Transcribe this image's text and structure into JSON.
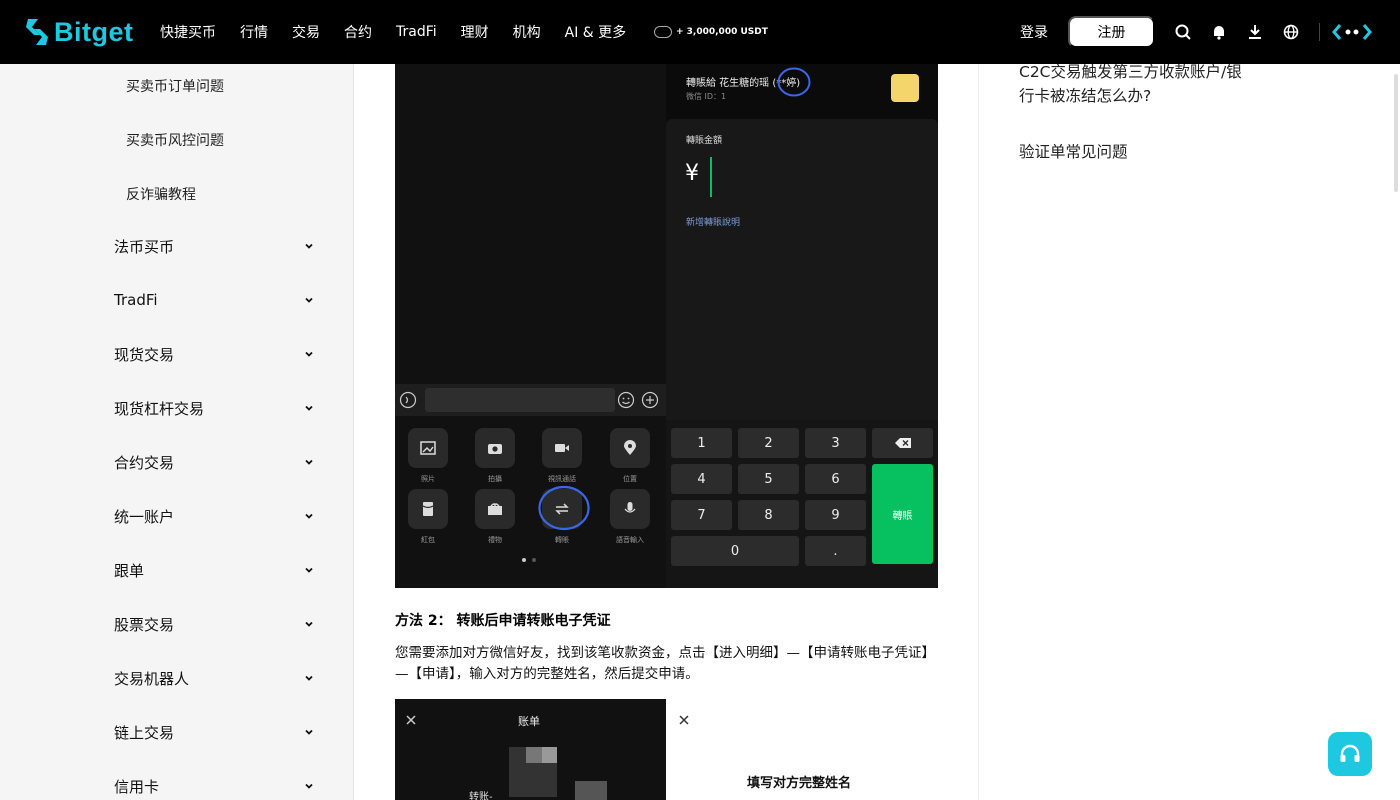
{
  "brand": {
    "name": "Bitget",
    "accent": "#1ec8e0"
  },
  "nav": {
    "items": [
      "快捷买币",
      "行情",
      "交易",
      "合约",
      "TradFi",
      "理财",
      "机构",
      "AI & 更多"
    ],
    "promo": "+ 3,000,000 USDT",
    "login": "登录",
    "register": "注册",
    "icons": [
      "search-icon",
      "bell-icon",
      "download-icon",
      "globe-icon",
      "more-icon"
    ]
  },
  "sidebar": {
    "subitems": [
      "买卖币订单问题",
      "买卖币风控问题",
      "反诈骗教程"
    ],
    "categories": [
      "法币买币",
      "TradFi",
      "现货交易",
      "现货杠杆交易",
      "合约交易",
      "统一账户",
      "跟单",
      "股票交易",
      "交易机器人",
      "链上交易",
      "信用卡"
    ]
  },
  "screenshot1": {
    "header": "轉賬給 花生糖的瑶 (**婷)",
    "wechat_id": "微信 ID：1",
    "amount_label": "轉賬金額",
    "currency": "¥",
    "add_note": "新增轉賬說明",
    "chat_grid": [
      {
        "icon": "photo-icon",
        "label": "照片"
      },
      {
        "icon": "camera-icon",
        "label": "拍攝"
      },
      {
        "icon": "video-icon",
        "label": "視訊通話"
      },
      {
        "icon": "location-icon",
        "label": "位置"
      },
      {
        "icon": "redpacket-icon",
        "label": "紅包"
      },
      {
        "icon": "gift-icon",
        "label": "禮物"
      },
      {
        "icon": "transfer-icon",
        "label": "轉賬"
      },
      {
        "icon": "mic-icon",
        "label": "語音輸入"
      }
    ],
    "keypad": [
      "1",
      "2",
      "3",
      "4",
      "5",
      "6",
      "7",
      "8",
      "9",
      "0",
      "."
    ],
    "send": "轉賬"
  },
  "article": {
    "method2_title": "方法 2： 转账后申请转账电子凭证",
    "method2_desc": "您需要添加对方微信好友，找到该笔收款资金，点击【进入明细】—【申请转账电子凭证】—【申请】，输入对方的完整姓名，然后提交申请。"
  },
  "screenshot2": {
    "bill_title": "账单",
    "transfer_label": "转账-",
    "fill_name": "填写对方完整姓名"
  },
  "related": {
    "links": [
      "C2C交易触发第三方收款账户/银行卡被冻结怎么办?",
      "验证单常见问题"
    ]
  }
}
